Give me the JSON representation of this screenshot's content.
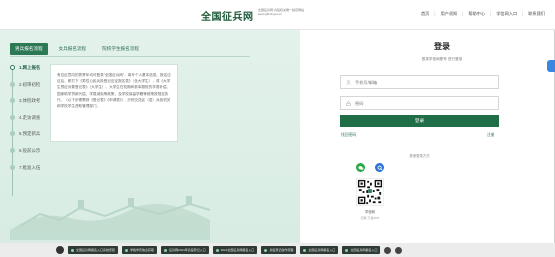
{
  "header": {
    "logo": "全国征兵网",
    "logo_sub_1": "全国征兵网·兵役机关唯一指定网站",
    "logo_sub_2": "www.gfbzb.gov.cn",
    "links": [
      "首页",
      "用户须知",
      "帮助中心",
      "学信网入口",
      "联系我们"
    ]
  },
  "tabs": [
    "男兵报名流程",
    "女兵报名流程",
    "院校学生报名流程"
  ],
  "steps": [
    "1.网上报名",
    "2.初审初检",
    "3.体检政考",
    "4.走访调查",
    "5.预定新兵",
    "6.役前公示",
    "7.批准入伍"
  ],
  "description": "有应征意向的男青年均可登录“全国征兵网”，填写个人基本信息、报名应征后，即打下《男性公民兵役登记应征报名表》（含大学生），或《大学生预征对象登记表》（大学生）。大学生在校期间参军服役的学费补偿、国家助学贷款代偿、学费减免等政策，及学校保留学籍等政策按规定执行。（以下步骤需到《登记表》《申请表》）, 分别交送区（县）兵役机关和学校学生资助管理部门。",
  "login": {
    "title": "登录",
    "subtitle": "登录学信网账号 进行登录",
    "account_placeholder": "手机号/邮箱",
    "password_placeholder": "密码",
    "button": "登录",
    "link_left": "找回密码",
    "link_right": "注册",
    "other_login": "其他登录方式",
    "qr_label": "学信网",
    "qr_sub": "扫码 下载APP"
  },
  "taskbar": [
    "全国征兵网报名入口系统安装",
    "学籍学历信息获取",
    "征兵网2024年兵役登记入口",
    "2024全国征兵网报名入口",
    "兵役登记操作流程",
    "全国征兵网报名入口",
    "全国征兵网报名入口"
  ],
  "colors": {
    "primary": "#1f6e48",
    "panel": "#e3f2eb",
    "accent": "#2c7a55"
  }
}
